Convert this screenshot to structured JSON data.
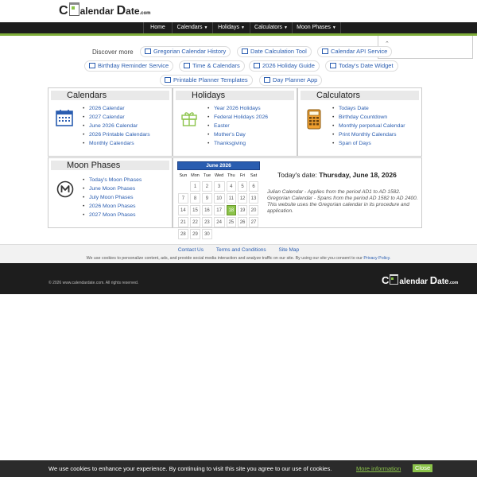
{
  "logo": {
    "c": "C",
    "alendar": "alendar",
    "d": "D",
    "ate": "ate",
    "dotcom": ".com"
  },
  "nav": {
    "items": [
      "Home",
      "Calendars",
      "Holidays",
      "Calculators",
      "Moon Phases"
    ]
  },
  "discover": {
    "label": "Discover more",
    "pills": [
      "Gregorian Calendar History",
      "Date Calculation Tool",
      "Calendar API Service",
      "Birthday Reminder Service",
      "Time & Calendars",
      "2026 Holiday Guide",
      "Today's Date Widget",
      "Printable Planner Templates",
      "Day Planner App"
    ]
  },
  "calendars": {
    "title": "Calendars",
    "links": [
      "2026 Calendar",
      "2027 Calendar",
      "June 2026 Calendar",
      "2026 Printable Calendars",
      "Monthly Calendars"
    ]
  },
  "holidays": {
    "title": "Holidays",
    "links": [
      "Year 2026 Holidays",
      "Federal Holidays 2026",
      "Easter",
      "Mother's Day",
      "Thanksgiving"
    ]
  },
  "calculators": {
    "title": "Calculators",
    "links": [
      "Todays Date",
      "Birthday Countdown",
      "Monthly perpetual Calendar",
      "Print Monthly Calendars",
      "Span of Days"
    ]
  },
  "moon": {
    "title": "Moon Phases",
    "links": [
      "Today's Moon Phases",
      "June Moon Phases",
      "July Moon Phases",
      "2026 Moon Phases",
      "2027 Moon Phases"
    ]
  },
  "mini_calendar": {
    "month": "June 2026",
    "weekdays": [
      "Sun",
      "Mon",
      "Tue",
      "Wed",
      "Thu",
      "Fri",
      "Sat"
    ],
    "weeks": [
      [
        "",
        "1",
        "2",
        "3",
        "4",
        "5",
        "6"
      ],
      [
        "7",
        "8",
        "9",
        "10",
        "11",
        "12",
        "13"
      ],
      [
        "14",
        "15",
        "16",
        "17",
        "18",
        "19",
        "20"
      ],
      [
        "21",
        "22",
        "23",
        "24",
        "25",
        "26",
        "27"
      ],
      [
        "28",
        "29",
        "30",
        "",
        "",
        "",
        ""
      ]
    ],
    "today": "18"
  },
  "today": {
    "label": "Today's date:",
    "value": "Thursday, June 18, 2026",
    "description": "Julian Calendar - Applies from the period AD1 to AD 1582. Gregorian Calendar - Spans from the period AD 1582 to AD 2400. This website uses the Gregorian calendar in its procedure and application."
  },
  "footer": {
    "links": [
      "Contact Us",
      "Terms and Conditions",
      "Site Map"
    ],
    "cookie_note": "We use cookies to personalize content, ads, and provide social media interaction and analyze traffic on our site. By using our site you consent to our",
    "privacy_link": "Privacy Policy.",
    "copyright": "© 2026 www.calendardate.com. All rights reserved."
  },
  "cookie_bar": {
    "message": "We use cookies to enhance your experience. By continuing to visit this site you agree to our use of cookies.",
    "more": "More information",
    "close": "Close"
  },
  "colors": {
    "accent": "#8bc34a",
    "link": "#2a5db0",
    "nav_bg": "#1d1d1d"
  }
}
